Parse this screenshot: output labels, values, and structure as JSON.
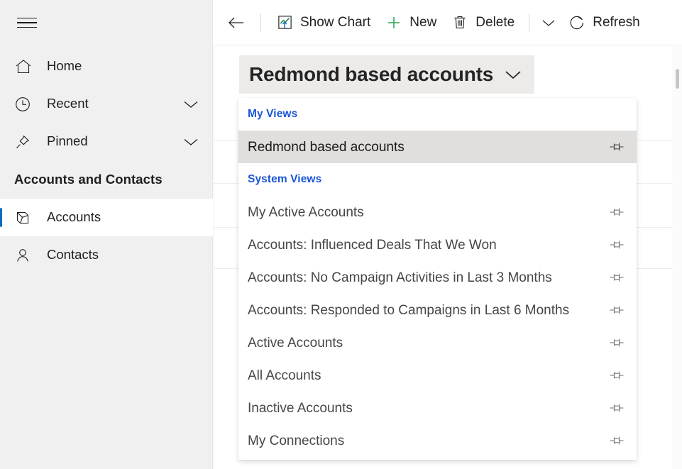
{
  "sidebar": {
    "menu_button": "hamburger-menu",
    "items": [
      {
        "label": "Home",
        "icon": "home-icon",
        "expandable": false,
        "selected": false
      },
      {
        "label": "Recent",
        "icon": "clock-icon",
        "expandable": true,
        "selected": false
      },
      {
        "label": "Pinned",
        "icon": "pin-icon",
        "expandable": true,
        "selected": false
      }
    ],
    "section_title": "Accounts and Contacts",
    "group_items": [
      {
        "label": "Accounts",
        "icon": "accounts-icon",
        "selected": true
      },
      {
        "label": "Contacts",
        "icon": "person-icon",
        "selected": false
      }
    ],
    "selection_color": "#0f6cbd",
    "background": "#f0f0f0"
  },
  "commandbar": {
    "back_label": "back-arrow",
    "buttons": [
      {
        "label": "Show Chart",
        "icon": "show-chart-icon"
      },
      {
        "label": "New",
        "icon": "plus-icon"
      },
      {
        "label": "Delete",
        "icon": "trash-icon"
      }
    ],
    "overflow_label": "chevron-down-icon",
    "refresh": {
      "label": "Refresh",
      "icon": "refresh-icon"
    }
  },
  "view_selector": {
    "current_view": "Redmond based accounts",
    "chevron": "chevron-down-icon",
    "open": true,
    "header_bg": "#edebe9",
    "groups": [
      {
        "title": "My Views",
        "title_color": "#1a56d6",
        "items": [
          {
            "label": "Redmond based accounts",
            "pin": "pin-icon",
            "current": true
          }
        ]
      },
      {
        "title": "System Views",
        "title_color": "#1a56d6",
        "items": [
          {
            "label": "My Active Accounts",
            "pin": "pin-icon",
            "current": false
          },
          {
            "label": "Accounts: Influenced Deals That We Won",
            "pin": "pin-icon",
            "current": false
          },
          {
            "label": "Accounts: No Campaign Activities in Last 3 Months",
            "pin": "pin-icon",
            "current": false
          },
          {
            "label": "Accounts: Responded to Campaigns in Last 6 Months",
            "pin": "pin-icon",
            "current": false
          },
          {
            "label": "Active Accounts",
            "pin": "pin-icon",
            "current": false
          },
          {
            "label": "All Accounts",
            "pin": "pin-icon",
            "current": false
          },
          {
            "label": "Inactive Accounts",
            "pin": "pin-icon",
            "current": false
          },
          {
            "label": "My Connections",
            "pin": "pin-icon",
            "current": false
          }
        ]
      }
    ],
    "highlight_color": "#e1dfdd"
  }
}
